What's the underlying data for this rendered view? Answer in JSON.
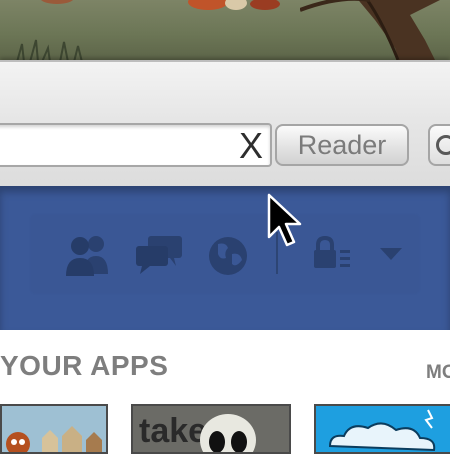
{
  "browser": {
    "url_clear_label": "X",
    "reader_label": "Reader"
  },
  "facebook": {
    "icons": [
      "friend-requests-icon",
      "messages-icon",
      "notifications-globe-icon",
      "privacy-lock-icon",
      "account-dropdown-icon"
    ]
  },
  "apps": {
    "title": "YOUR APPS",
    "more_label": "MO",
    "tiles": [
      {
        "icon": "game-app-thumbnail"
      },
      {
        "caption": "take",
        "icon": "take-app-thumbnail"
      },
      {
        "icon": "cloud-app-thumbnail"
      }
    ]
  },
  "colors": {
    "facebook_blue": "#3b5998",
    "chrome_gray": "#e6e6e6",
    "heading_gray": "#7e7e7e"
  }
}
